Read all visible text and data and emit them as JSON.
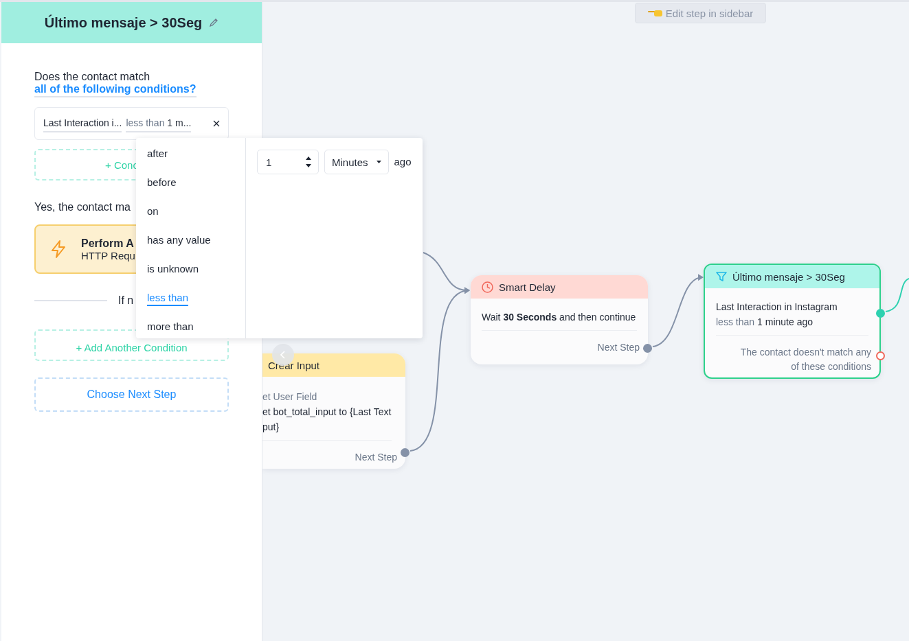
{
  "hint": {
    "label": "Edit step in sidebar"
  },
  "sidebar": {
    "title": "Último mensaje > 30Seg",
    "question": "Does the contact match",
    "match_mode": "all of the following conditions?",
    "condition": {
      "field": "Last Interaction i...",
      "operator": "less than",
      "value": "1 m..."
    },
    "add_condition_top": "+ Conc",
    "yes_label": "Yes, the contact ma",
    "action_card": {
      "title": "Perform A",
      "subtitle": "HTTP Requ"
    },
    "no_label": "If n",
    "add_condition": "+ Add Another Condition",
    "next_step": "Choose Next Step"
  },
  "dropdown": {
    "operators": [
      {
        "label": "after",
        "selected": false
      },
      {
        "label": "before",
        "selected": false
      },
      {
        "label": "on",
        "selected": false
      },
      {
        "label": "has any value",
        "selected": false
      },
      {
        "label": "is unknown",
        "selected": false
      },
      {
        "label": "less than",
        "selected": true
      },
      {
        "label": "more than",
        "selected": false
      }
    ],
    "amount": "1",
    "unit": "Minutes",
    "suffix": "ago"
  },
  "nodes": [
    {
      "kind": "action",
      "title": "Crear Input",
      "selected": false,
      "lines": [
        [
          {
            "text": "et User Field",
            "kind": "muted"
          }
        ],
        [
          {
            "text": "et bot_total_input to {Last Text",
            "kind": "plain"
          }
        ],
        [
          {
            "text": "put}",
            "kind": "plain"
          }
        ]
      ],
      "footer": "Next Step"
    },
    {
      "kind": "delay",
      "title": "Smart Delay",
      "selected": false,
      "lines": [
        [
          {
            "text": "Wait **30 Seconds** and then continue",
            "kind": "plain"
          }
        ]
      ],
      "footer": "Next Step"
    },
    {
      "kind": "condition",
      "title": "Último mensaje > 30Seg",
      "selected": true,
      "lines": [
        [
          {
            "text": "Last Interaction in Instagram",
            "kind": "plain"
          }
        ],
        [
          {
            "text": "less than",
            "kind": "muted"
          },
          {
            "text": "1 minute ago",
            "kind": "plain"
          }
        ]
      ],
      "footer": "The contact doesn't match any of these conditions"
    }
  ]
}
